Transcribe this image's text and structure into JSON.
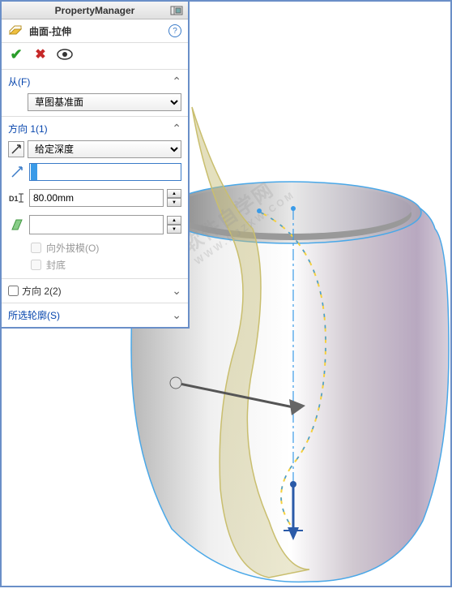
{
  "panel": {
    "title": "PropertyManager",
    "feature": {
      "label": "曲面-拉伸"
    },
    "sections": {
      "from": {
        "title": "从(F)",
        "selected": "草图基准面"
      },
      "direction1": {
        "title": "方向 1(1)",
        "endCondition": "给定深度",
        "distanceLabel": "D1",
        "distance": "80.00mm",
        "draftOutward": "向外拔模(O)",
        "capEnd": "封底"
      },
      "direction2": {
        "title": "方向 2(2)"
      },
      "contours": {
        "title": "所选轮廓(S)"
      }
    }
  },
  "watermark": {
    "line1": "软件自学网",
    "line2": "WWW.RJZXW.COM"
  }
}
